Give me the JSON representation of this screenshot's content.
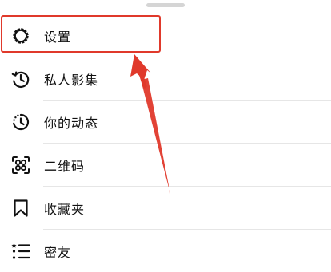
{
  "menu": {
    "items": [
      {
        "label": "设置",
        "icon": "settings-gear-icon"
      },
      {
        "label": "私人影集",
        "icon": "history-icon"
      },
      {
        "label": "你的动态",
        "icon": "activity-icon"
      },
      {
        "label": "二维码",
        "icon": "qr-code-icon"
      },
      {
        "label": "收藏夹",
        "icon": "bookmark-icon"
      },
      {
        "label": "密友",
        "icon": "close-friends-list-icon"
      }
    ]
  },
  "annotation": {
    "highlight_color": "#e0392b",
    "arrow_color": "#e0392b",
    "highlighted_item": "设置"
  },
  "colors": {
    "background": "#ffffff",
    "text": "#111111",
    "divider": "#e6e6e6",
    "handle": "#d5d5d5"
  }
}
